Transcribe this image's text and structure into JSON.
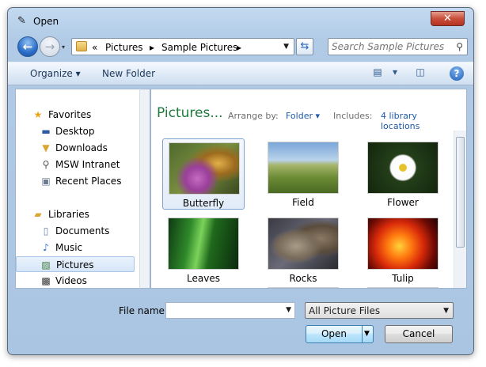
{
  "window": {
    "title": "Open",
    "close_label": "✕"
  },
  "address": {
    "crumbs": [
      "«",
      "Pictures",
      "▸",
      "Sample Pictures",
      "▸"
    ]
  },
  "search": {
    "placeholder": "Search Sample Pictures"
  },
  "toolbar": {
    "organize": "Organize ▾",
    "new_folder": "New Folder",
    "view_drop": "▾",
    "help": "?"
  },
  "nav": {
    "favorites": "Favorites",
    "desktop": "Desktop",
    "downloads": "Downloads",
    "msw": "MSW Intranet",
    "recent": "Recent Places",
    "libraries": "Libraries",
    "documents": "Documents",
    "music": "Music",
    "pictures": "Pictures",
    "videos": "Videos"
  },
  "content": {
    "title": "Pictures...",
    "arrange_label": "Arrange by:",
    "arrange_value": "Folder ▾",
    "includes_label": "Includes:",
    "includes_value": "4 library locations",
    "items": [
      "Butterfly",
      "Field",
      "Flower",
      "Leaves",
      "Rocks",
      "Tulip"
    ]
  },
  "footer": {
    "file_name_label": "File name:",
    "file_name_value": "",
    "filter_value": "All Picture Files",
    "open_label": "Open",
    "cancel_label": "Cancel"
  }
}
